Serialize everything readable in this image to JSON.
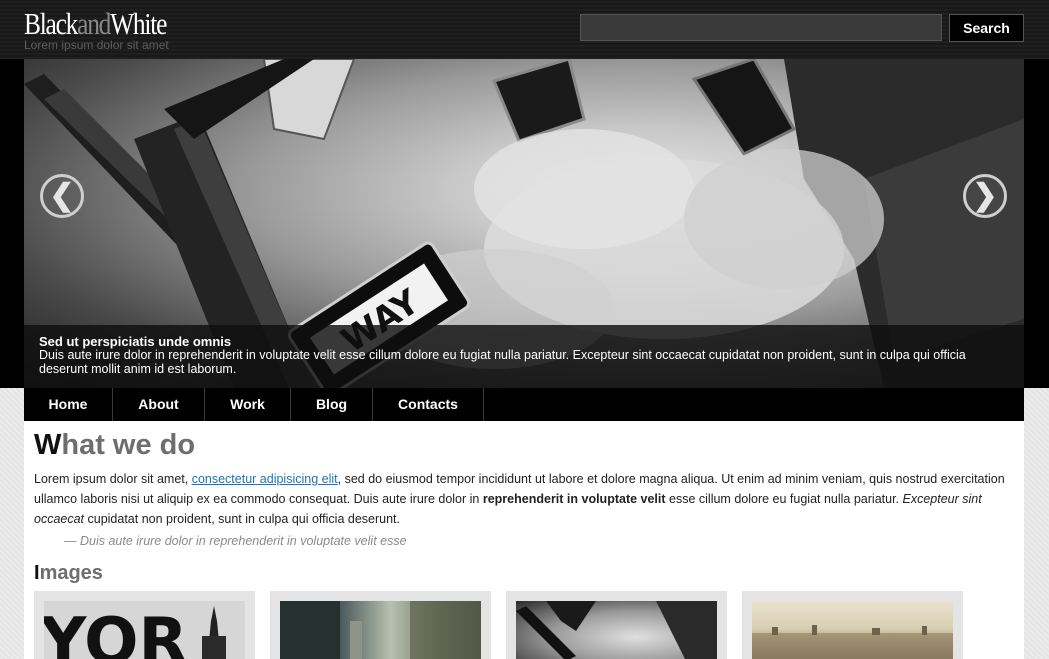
{
  "header": {
    "logo_black": "Black",
    "logo_and": "and",
    "logo_white": "White",
    "tagline": "Lorem ipsum dolor sit amet",
    "search_placeholder": "",
    "search_label": "Search"
  },
  "slider": {
    "prev_glyph": "❮",
    "next_glyph": "❯",
    "sign_text": "WAY",
    "caption_title": "Sed ut perspiciatis unde omnis",
    "caption_text": "Duis aute irure dolor in reprehenderit in voluptate velit esse cillum dolore eu fugiat nulla pariatur. Excepteur sint occaecat cupidatat non proident, sunt in culpa qui officia deserunt mollit anim id est laborum."
  },
  "nav": {
    "items": [
      {
        "label": "Home"
      },
      {
        "label": "About"
      },
      {
        "label": "Work"
      },
      {
        "label": "Blog"
      },
      {
        "label": "Contacts"
      }
    ]
  },
  "main": {
    "heading_first": "W",
    "heading_rest": "hat we do",
    "para_1": "Lorem ipsum dolor sit amet, ",
    "para_link": "consectetur adipisicing elit",
    "para_2": ", sed do eiusmod tempor incididunt ut labore et dolore magna aliqua. Ut enim ad minim veniam, quis nostrud exercitation ullamco laboris nisi ut aliquip ex ea commodo consequat. Duis aute irure dolor in ",
    "para_bold": "reprehenderit in voluptate velit",
    "para_3": " esse cillum dolore eu fugiat nulla pariatur. ",
    "para_italic": "Excepteur sint occaecat",
    "para_4": " cupidatat non proident, sunt in culpa qui officia deserunt.",
    "quote": "— Duis aute irure dolor in reprehenderit in voluptate velit esse",
    "images_first": "I",
    "images_rest": "mages",
    "thumb_1_text": "YOR"
  }
}
